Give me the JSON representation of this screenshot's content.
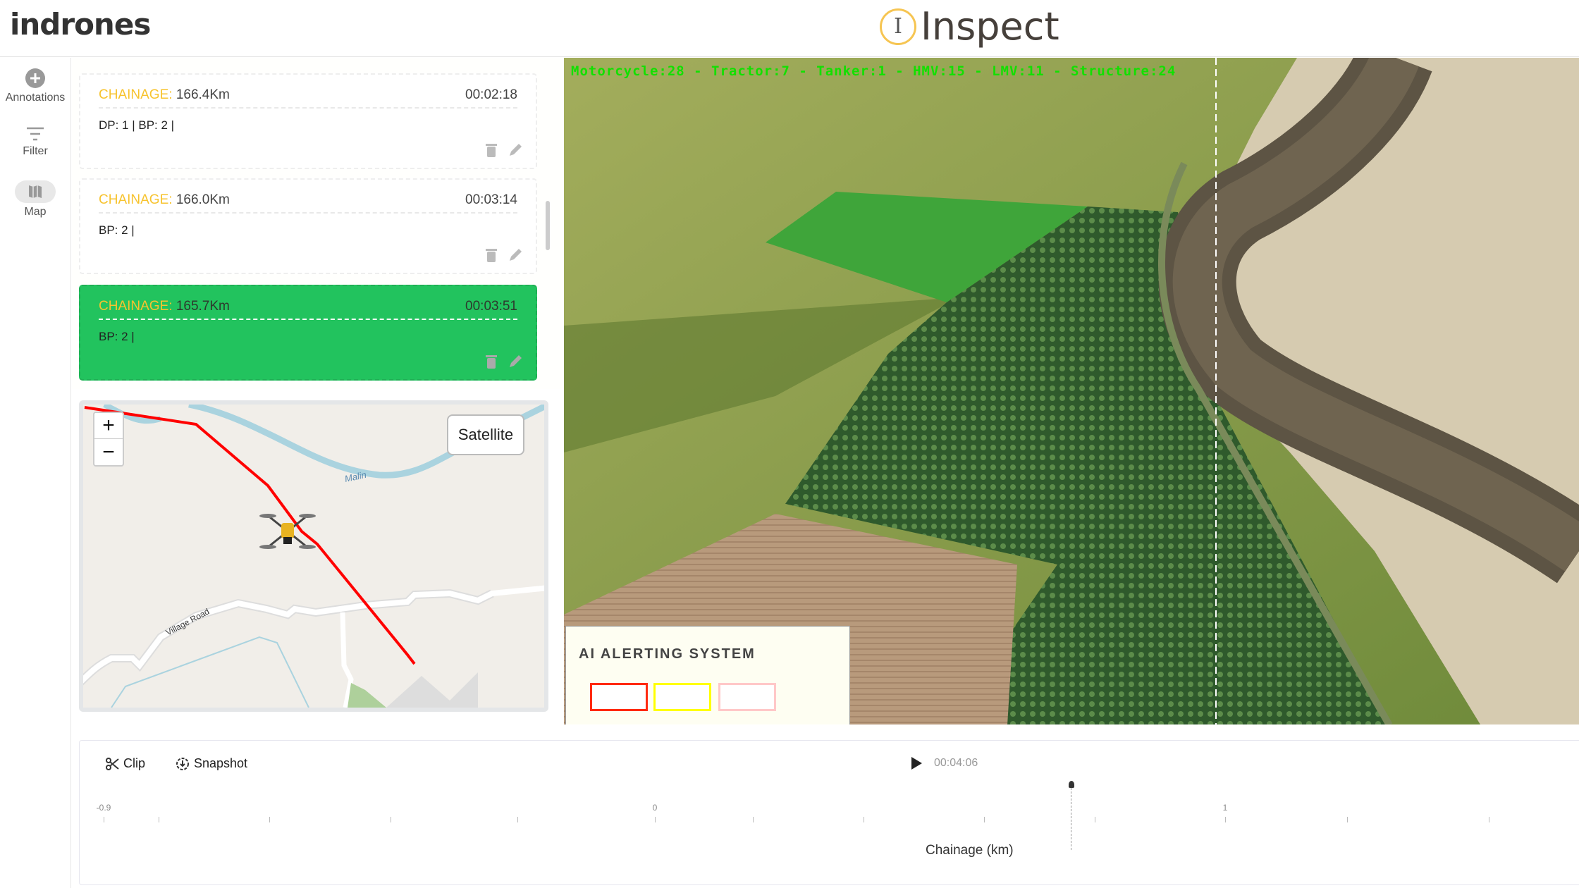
{
  "header": {
    "logo": "indrones",
    "app_title": "Inspect",
    "app_icon_letter": "I"
  },
  "sidebar": {
    "items": [
      {
        "label": "Annotations",
        "icon": "plus-circle-icon"
      },
      {
        "label": "Filter",
        "icon": "filter-icon"
      },
      {
        "label": "Map",
        "icon": "map-icon"
      }
    ]
  },
  "annotations": [
    {
      "chainage_label": "CHAINAGE:",
      "chainage": "166.4Km",
      "time": "00:02:18",
      "tags": "DP: 1 | BP: 2 |",
      "active": false
    },
    {
      "chainage_label": "CHAINAGE:",
      "chainage": "166.0Km",
      "time": "00:03:14",
      "tags": "BP: 2 |",
      "active": false
    },
    {
      "chainage_label": "CHAINAGE:",
      "chainage": "165.7Km",
      "time": "00:03:51",
      "tags": "BP: 2 |",
      "active": true
    }
  ],
  "colors": {
    "accent_green": "#22c35e",
    "chainage_label": "#f7c32e",
    "route": "#ff0000",
    "overlay_text": "#12e000"
  },
  "map": {
    "zoom_in": "+",
    "zoom_out": "−",
    "layer_button": "Satellite",
    "labels": [
      "Malin",
      "Village Road"
    ]
  },
  "video": {
    "detections": "Motorcycle:28 - Tractor:7 - Tanker:1 - HMV:15 - LMV:11 - Structure:24",
    "alert_title": "AI ALERTING SYSTEM",
    "alert_colors": [
      "#ff2a10",
      "#ffff00",
      "#ffc8c8"
    ]
  },
  "timeline": {
    "clip": "Clip",
    "snapshot": "Snapshot",
    "time": "00:04:06",
    "axis_label": "Chainage (km)",
    "tick_labels": [
      "-0.9",
      "0",
      "1"
    ]
  }
}
